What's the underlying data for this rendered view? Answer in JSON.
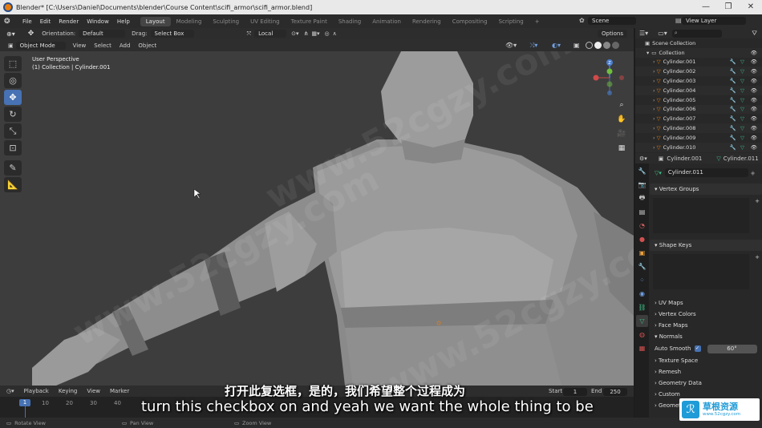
{
  "window": {
    "title": "Blender* [C:\\Users\\Daniel\\Documents\\blender\\Course Content\\scifi_armor\\scifi_armor.blend]",
    "minimize": "—",
    "maximize": "❐",
    "close": "✕"
  },
  "menubar": {
    "items": [
      "File",
      "Edit",
      "Render",
      "Window",
      "Help"
    ],
    "workspaces": [
      "Layout",
      "Modeling",
      "Sculpting",
      "UV Editing",
      "Texture Paint",
      "Shading",
      "Animation",
      "Rendering",
      "Compositing",
      "Scripting"
    ],
    "active_workspace": "Layout",
    "add_tab": "+",
    "scene": "Scene",
    "view_layer": "View Layer"
  },
  "header": {
    "orientation_label": "Orientation:",
    "orientation_value": "Default",
    "drag_label": "Drag:",
    "drag_value": "Select Box",
    "transform": "Local",
    "options": "Options"
  },
  "header2": {
    "mode": "Object Mode",
    "items": [
      "View",
      "Select",
      "Add",
      "Object"
    ]
  },
  "viewport": {
    "perspective": "User Perspective",
    "context": "(1) Collection | Cylinder.001"
  },
  "gizmo": {
    "x": "X",
    "y": "Y",
    "z": "Z"
  },
  "outliner": {
    "root": "Scene Collection",
    "collection": "Collection",
    "objects": [
      "Cylinder.001",
      "Cylinder.002",
      "Cylinder.003",
      "Cylinder.004",
      "Cylinder.005",
      "Cylinder.006",
      "Cylinder.007",
      "Cylinder.008",
      "Cylinder.009",
      "Cylinder.010"
    ]
  },
  "properties": {
    "breadcrumb_object": "Cylinder.001",
    "breadcrumb_data": "Cylinder.011",
    "mesh_name": "Cylinder.011",
    "panels": {
      "vertex_groups": "Vertex Groups",
      "shape_keys": "Shape Keys",
      "uv_maps": "UV Maps",
      "vertex_colors": "Vertex Colors",
      "face_maps": "Face Maps",
      "normals": "Normals",
      "auto_smooth": "Auto Smooth",
      "angle": "60°",
      "texture_space": "Texture Space",
      "remesh": "Remesh",
      "geometry_data": "Geometry Data",
      "custom_props": "Custom",
      "geometry_nodes": "Geomet"
    }
  },
  "timeline": {
    "menus": [
      "Playback",
      "Keying",
      "View",
      "Marker"
    ],
    "start_label": "Start",
    "start": "1",
    "end_label": "End",
    "end": "250",
    "current": "1",
    "ticks": [
      "1",
      "10",
      "20",
      "30",
      "40"
    ]
  },
  "status": {
    "left": "Rotate View",
    "mid": "Pan View",
    "right": "Zoom View"
  },
  "subtitles": {
    "zh": "打开此复选框，是的，我们希望整个过程成为",
    "en": "turn this checkbox on and yeah we want the whole thing to be"
  },
  "watermark": {
    "text": "www.52cgzy.com",
    "logo_cn": "草根资源",
    "logo_url": "www.52cgzy.com",
    "logo_mark": "ℛ"
  },
  "colors": {
    "accent": "#4772b3",
    "selected": "#e87d0d",
    "mesh_green": "#3fbf8a"
  }
}
